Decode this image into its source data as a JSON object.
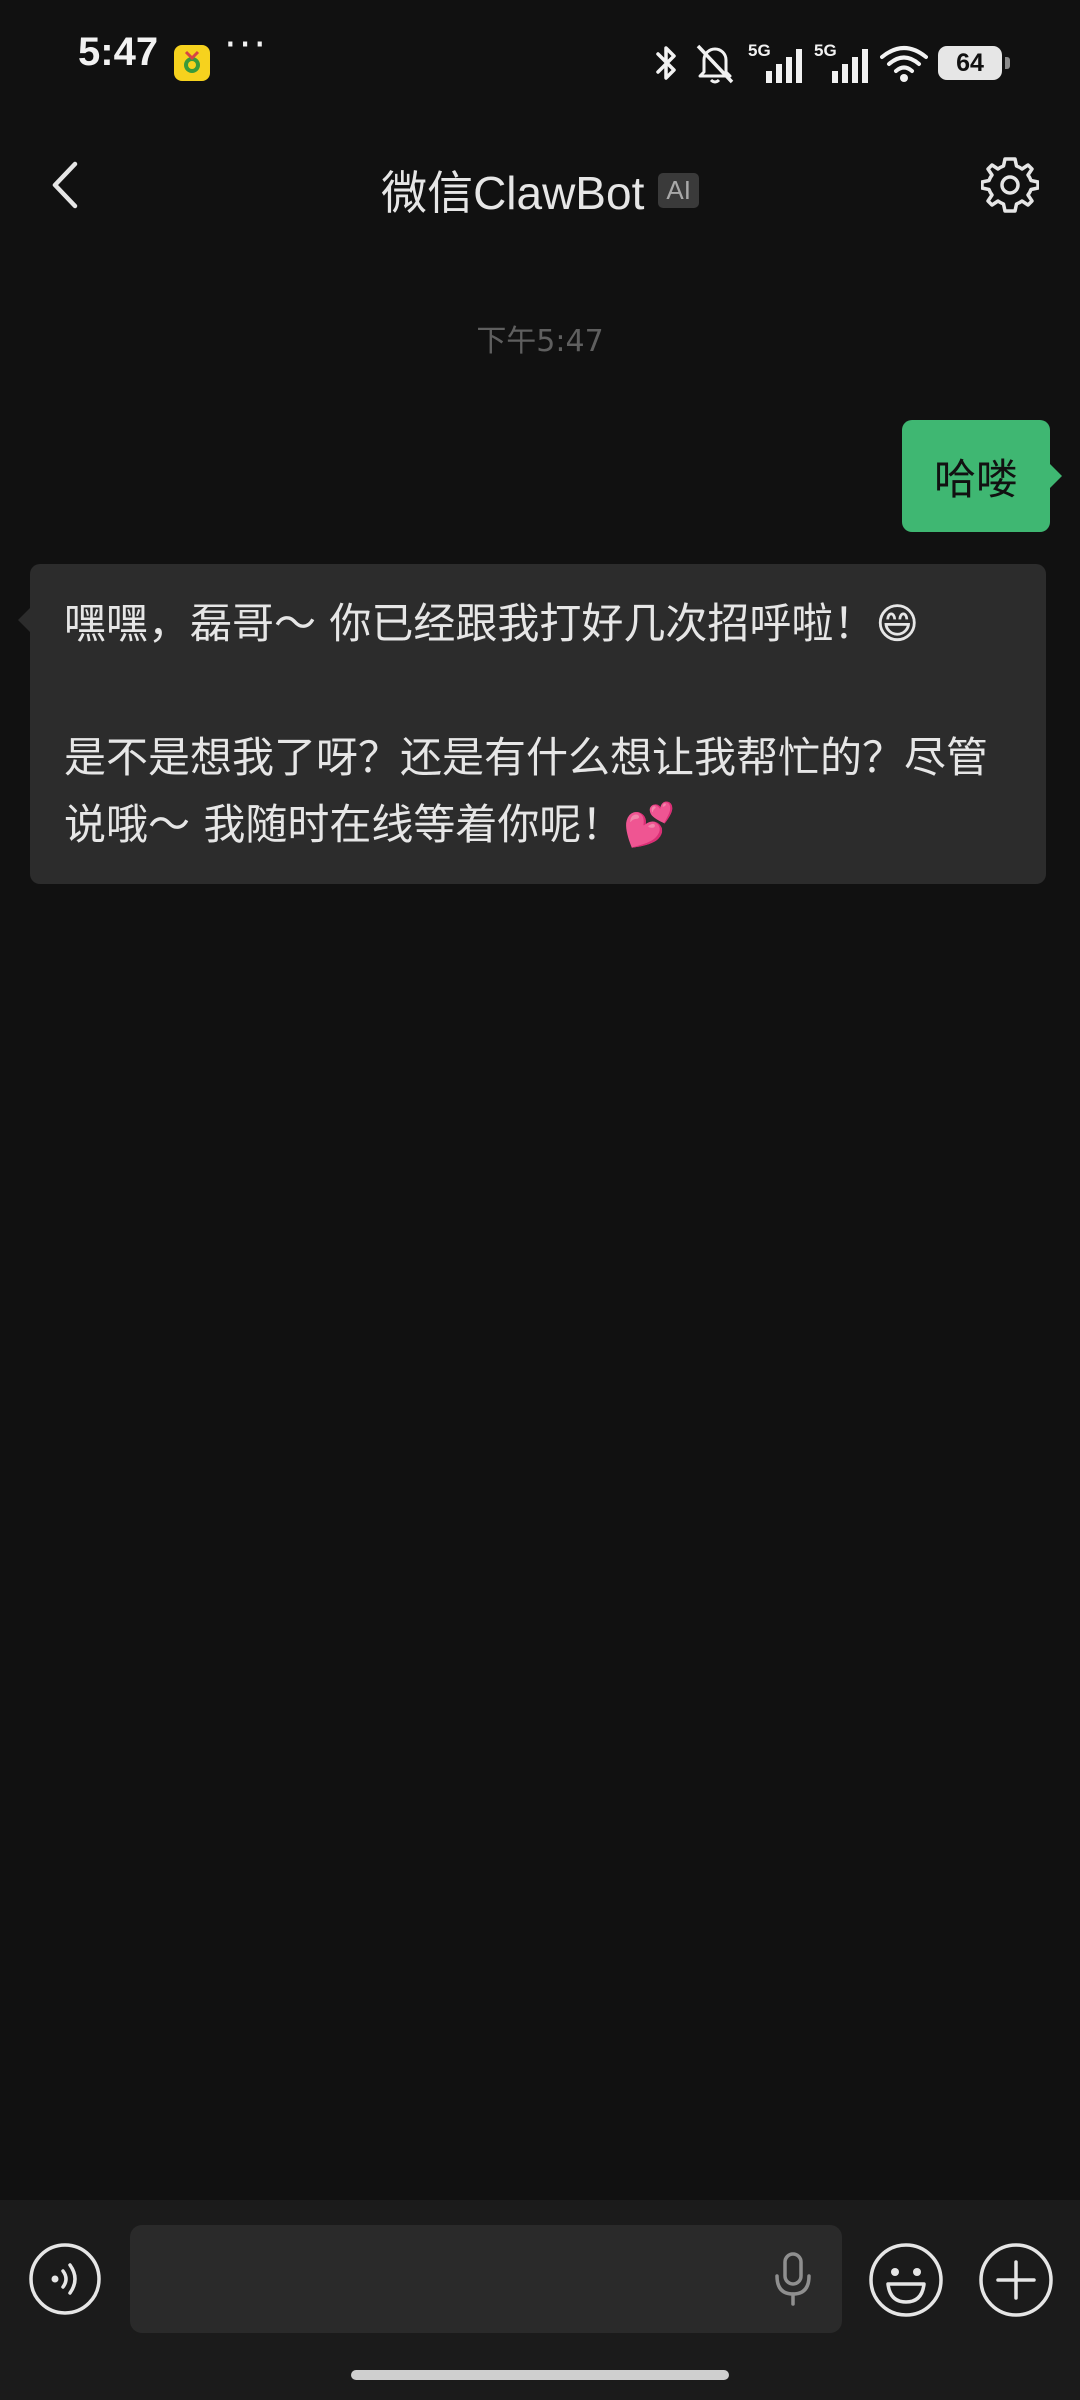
{
  "status_bar": {
    "time": "5:47",
    "more": "···",
    "battery": "64",
    "network_1": "5G",
    "network_2": "5G"
  },
  "header": {
    "title": "微信ClawBot",
    "badge": "AI"
  },
  "chat": {
    "timestamp": "下午5:47",
    "messages": [
      {
        "sender": "me",
        "text": "哈喽"
      },
      {
        "sender": "bot",
        "paragraphs": [
          "嘿嘿，磊哥～ 你已经跟我打好几次招呼啦！😄",
          "是不是想我了呀？还是有什么想让我帮忙的？尽管说哦～ 我随时在线等着你呢！💕"
        ]
      }
    ]
  },
  "input_bar": {
    "value": "",
    "placeholder": ""
  },
  "icons": {
    "back": "chevron-left-icon",
    "settings": "gear-icon",
    "voice": "voice-icon",
    "mic": "mic-icon",
    "emoji": "smiley-icon",
    "plus": "plus-icon"
  },
  "colors": {
    "background": "#111111",
    "sent_bubble": "#3fb772",
    "received_bubble": "#2c2c2c",
    "input_bar": "#1b1b1b"
  }
}
